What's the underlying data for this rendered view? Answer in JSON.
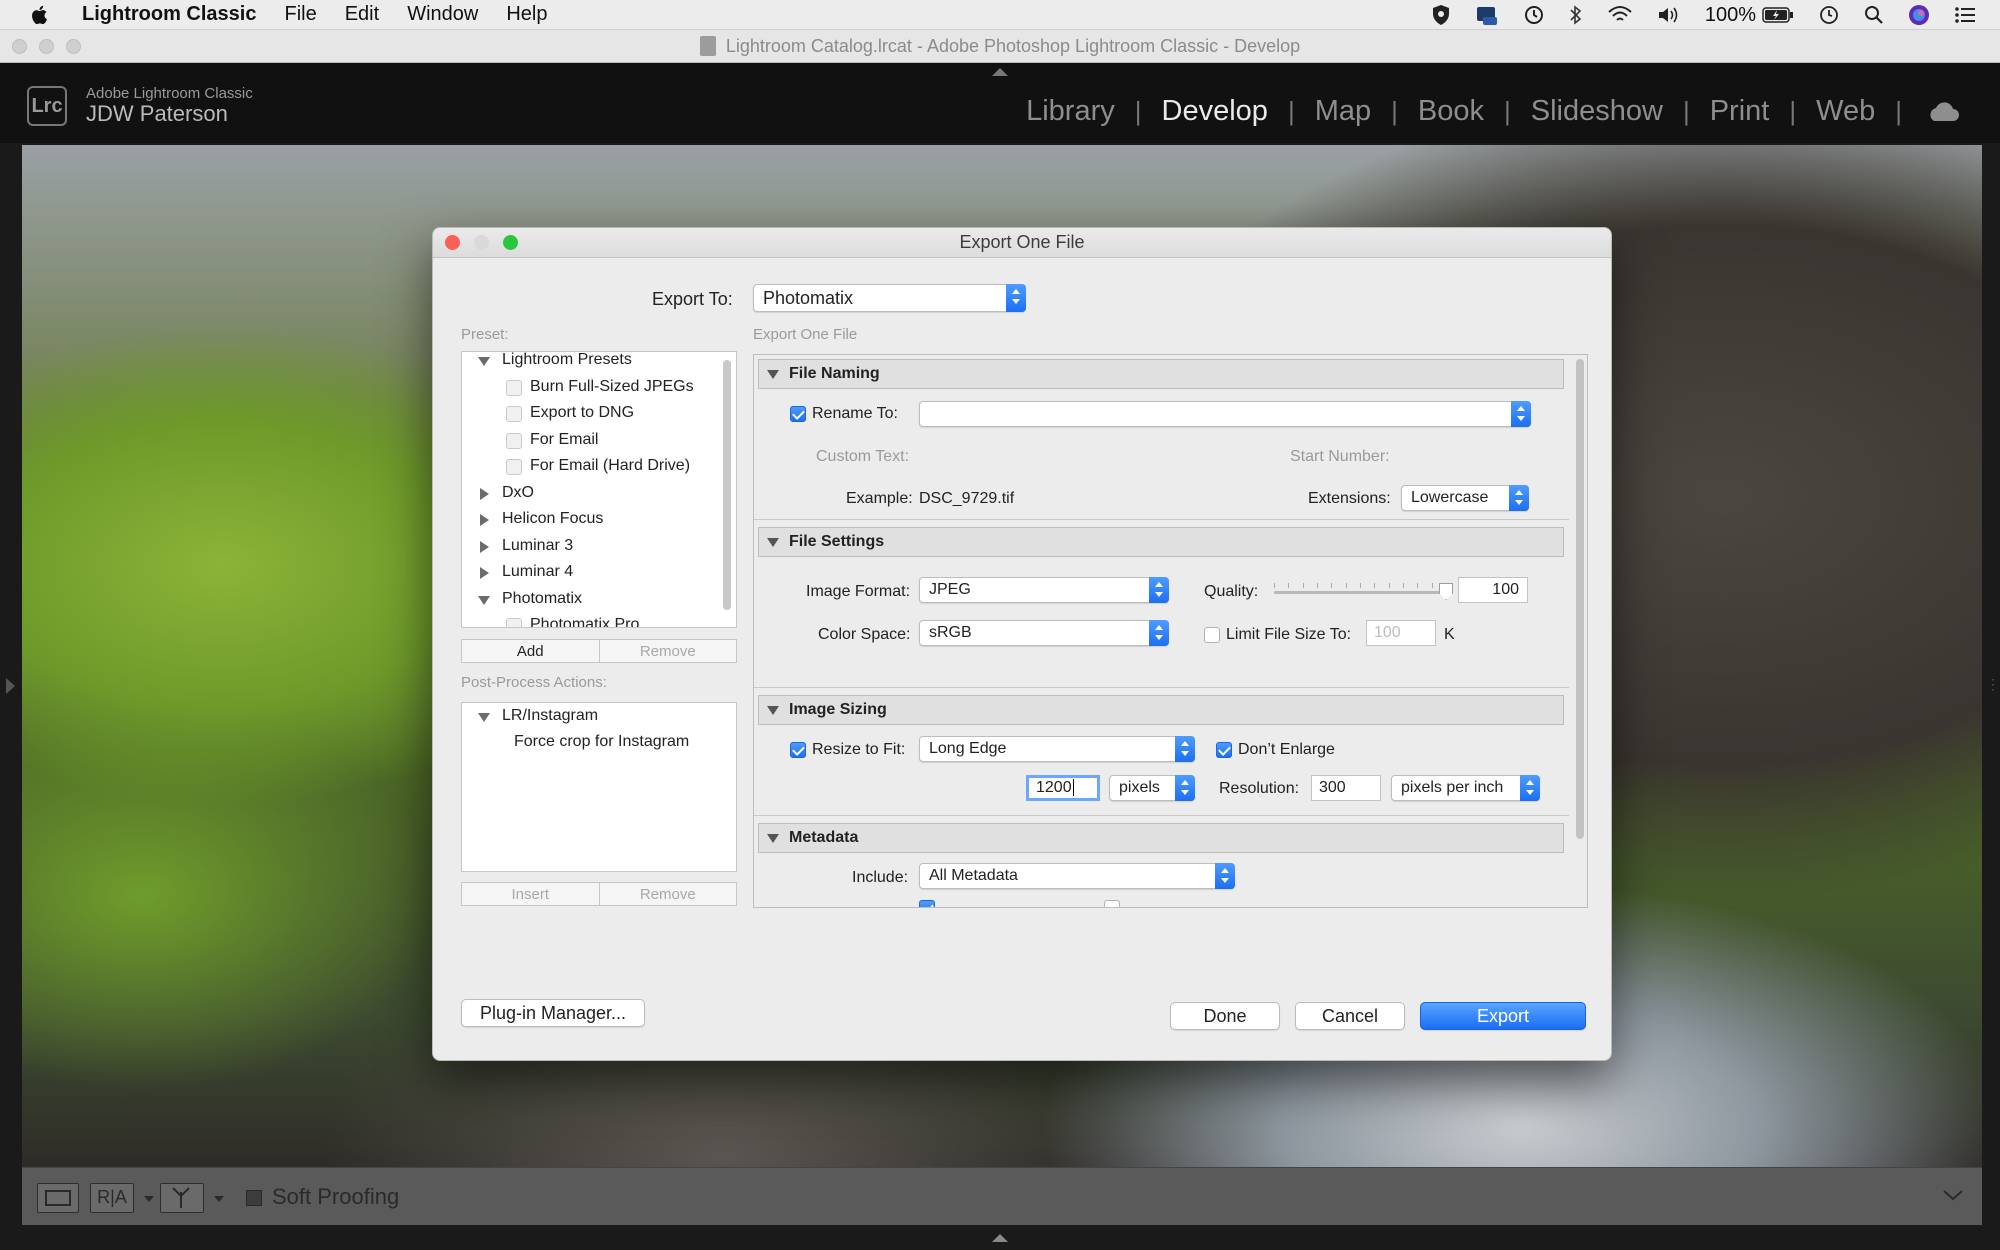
{
  "menubar": {
    "app_name": "Lightroom Classic",
    "items": [
      "File",
      "Edit",
      "Window",
      "Help"
    ],
    "battery_text": "100%"
  },
  "window": {
    "title": "Lightroom Catalog.lrcat - Adobe Photoshop Lightroom Classic - Develop"
  },
  "lr_header": {
    "logo": "Lrc",
    "product": "Adobe Lightroom Classic",
    "user": "JDW Paterson",
    "modules": [
      "Library",
      "Develop",
      "Map",
      "Book",
      "Slideshow",
      "Print",
      "Web"
    ],
    "active_module": "Develop"
  },
  "dialog": {
    "title": "Export One File",
    "export_to_label": "Export To:",
    "export_to_value": "Photomatix",
    "preset_label": "Preset:",
    "section_caption": "Export One File",
    "presets": [
      {
        "label": "Lightroom Presets",
        "type": "folder",
        "open": true
      },
      {
        "label": "Burn Full-Sized JPEGs",
        "type": "item"
      },
      {
        "label": "Export to DNG",
        "type": "item"
      },
      {
        "label": "For Email",
        "type": "item"
      },
      {
        "label": "For Email (Hard Drive)",
        "type": "item"
      },
      {
        "label": "DxO",
        "type": "folder",
        "open": false
      },
      {
        "label": "Helicon Focus",
        "type": "folder",
        "open": false
      },
      {
        "label": "Luminar 3",
        "type": "folder",
        "open": false
      },
      {
        "label": "Luminar 4",
        "type": "folder",
        "open": false
      },
      {
        "label": "Photomatix",
        "type": "folder",
        "open": true
      },
      {
        "label": "Photomatix Pro",
        "type": "item"
      }
    ],
    "preset_add": "Add",
    "preset_remove": "Remove",
    "post_process_label": "Post-Process Actions:",
    "post_process": [
      {
        "label": "LR/Instagram",
        "type": "folder",
        "open": true
      },
      {
        "label": "Force crop for Instagram",
        "type": "action"
      }
    ],
    "pp_insert": "Insert",
    "pp_remove": "Remove",
    "file_naming": {
      "header": "File Naming",
      "rename_label": "Rename To:",
      "rename_checked": true,
      "rename_value": "",
      "custom_text_label": "Custom Text:",
      "start_number_label": "Start Number:",
      "example_label": "Example:",
      "example_value": "DSC_9729.tif",
      "extensions_label": "Extensions:",
      "extensions_value": "Lowercase"
    },
    "file_settings": {
      "header": "File Settings",
      "format_label": "Image Format:",
      "format_value": "JPEG",
      "quality_label": "Quality:",
      "quality_value": "100",
      "quality_fraction": 1.0,
      "colorspace_label": "Color Space:",
      "colorspace_value": "sRGB",
      "limit_label": "Limit File Size To:",
      "limit_checked": false,
      "limit_value": "100",
      "limit_unit": "K"
    },
    "image_sizing": {
      "header": "Image Sizing",
      "resize_label": "Resize to Fit:",
      "resize_checked": true,
      "resize_value": "Long Edge",
      "dont_enlarge_label": "Don’t Enlarge",
      "dont_enlarge_checked": true,
      "size_value": "1200",
      "size_unit": "pixels",
      "resolution_label": "Resolution:",
      "resolution_value": "300",
      "resolution_unit": "pixels per inch"
    },
    "metadata": {
      "header": "Metadata",
      "include_label": "Include:",
      "include_value": "All Metadata"
    },
    "plugin_manager": "Plug-in Manager...",
    "done": "Done",
    "cancel": "Cancel",
    "export": "Export"
  },
  "toolbar": {
    "soft_proofing": "Soft Proofing",
    "soft_proofing_checked": false,
    "ra_label": "R|A"
  },
  "colors": {
    "accent": "#1b6ff2",
    "close_light": "#fc5f57",
    "minimize_light": "#d9d9d9",
    "zoom_light": "#29c740"
  }
}
